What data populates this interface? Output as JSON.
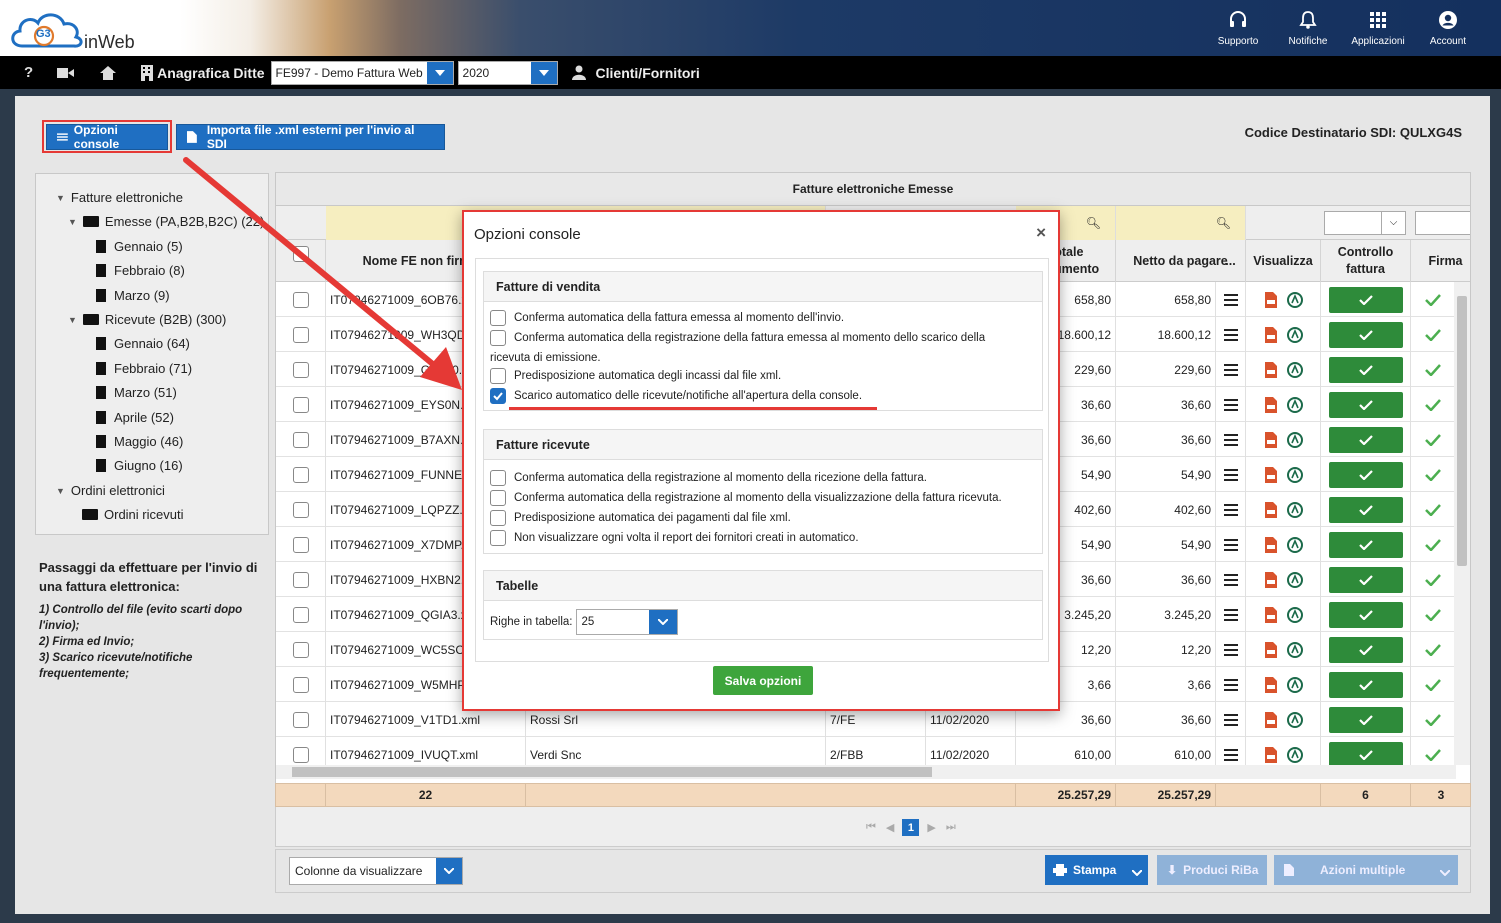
{
  "header": {
    "logo_badge": "G3",
    "app_name": "inWeb",
    "icons": [
      {
        "label": "Supporto",
        "icon": "headset-icon"
      },
      {
        "label": "Notifiche",
        "icon": "bell-icon"
      },
      {
        "label": "Applicazioni",
        "icon": "grid-icon"
      },
      {
        "label": "Account",
        "icon": "user-icon"
      }
    ]
  },
  "navbar": {
    "help": "?",
    "section_label": "Anagrafica Ditte",
    "company_value": "FE997 - Demo Fattura Web",
    "year_value": "2020",
    "clients_label": "Clienti/Fornitori"
  },
  "toolbar": {
    "options_label": "Opzioni console",
    "import_label": "Importa file .xml esterni per l'invio al SDI",
    "sdi_code": "Codice Destinatario SDI: QULXG4S"
  },
  "tree": [
    "Fatture elettroniche",
    "Emesse (PA,B2B,B2C) (22)",
    "Gennaio (5)",
    "Febbraio (8)",
    "Marzo (9)",
    "Ricevute (B2B) (300)",
    "Gennaio (64)",
    "Febbraio (71)",
    "Marzo (51)",
    "Aprile (52)",
    "Maggio (46)",
    "Giugno (16)",
    "Ordini elettronici",
    "Ordini ricevuti"
  ],
  "steps": {
    "title": "Passaggi da effettuare per l'invio di una fattura elettronica:",
    "items": [
      "1) Controllo del file (evito scarti dopo l'invio);",
      "2) Firma ed Invio;",
      "3) Scarico ricevute/notifiche frequentemente;"
    ]
  },
  "grid": {
    "title": "Fatture elettroniche Emesse",
    "headers": {
      "name": "Nome FE non firmata",
      "total": "Totale documento",
      "net": "Netto da pagare",
      "more": "...",
      "view": "Visualizza",
      "control": "Controllo fattura",
      "sign": "Firma"
    },
    "rows": [
      {
        "name": "IT07946271009_6OB76.xml",
        "client": "",
        "num": "",
        "date": "",
        "total": "658,80",
        "net": "658,80"
      },
      {
        "name": "IT07946271009_WH3QD.xml",
        "client": "",
        "num": "",
        "date": "",
        "total": "18.600,12",
        "net": "18.600,12"
      },
      {
        "name": "IT07946271009_GZ2Y0.xml",
        "client": "",
        "num": "",
        "date": "",
        "total": "229,60",
        "net": "229,60"
      },
      {
        "name": "IT07946271009_EYS0N.xml",
        "client": "",
        "num": "",
        "date": "",
        "total": "36,60",
        "net": "36,60"
      },
      {
        "name": "IT07946271009_B7AXN.xml",
        "client": "",
        "num": "",
        "date": "",
        "total": "36,60",
        "net": "36,60"
      },
      {
        "name": "IT07946271009_FUNNE.xml",
        "client": "",
        "num": "",
        "date": "",
        "total": "54,90",
        "net": "54,90"
      },
      {
        "name": "IT07946271009_LQPZZ.xml",
        "client": "",
        "num": "",
        "date": "",
        "total": "402,60",
        "net": "402,60"
      },
      {
        "name": "IT07946271009_X7DMP.xml",
        "client": "",
        "num": "",
        "date": "",
        "total": "54,90",
        "net": "54,90"
      },
      {
        "name": "IT07946271009_HXBN2.xml",
        "client": "",
        "num": "",
        "date": "",
        "total": "36,60",
        "net": "36,60"
      },
      {
        "name": "IT07946271009_QGIA3.xml",
        "client": "",
        "num": "",
        "date": "",
        "total": "3.245,20",
        "net": "3.245,20"
      },
      {
        "name": "IT07946271009_WC5SC.xml",
        "client": "",
        "num": "",
        "date": "",
        "total": "12,20",
        "net": "12,20"
      },
      {
        "name": "IT07946271009_W5MHP.xml",
        "client": "",
        "num": "",
        "date": "",
        "total": "3,66",
        "net": "3,66"
      },
      {
        "name": "IT07946271009_V1TD1.xml",
        "client": "Rossi Srl",
        "num": "7/FE",
        "date": "11/02/2020",
        "total": "36,60",
        "net": "36,60"
      },
      {
        "name": "IT07946271009_IVUQT.xml",
        "client": "Verdi Snc",
        "num": "2/FBB",
        "date": "11/02/2020",
        "total": "610,00",
        "net": "610,00"
      }
    ],
    "totals": {
      "count": "22",
      "total": "25.257,29",
      "net": "25.257,29",
      "control": "6",
      "sign": "3"
    },
    "page": "1"
  },
  "bottom": {
    "columns_label": "Colonne da visualizzare",
    "print_label": "Stampa",
    "riba_label": "Produci RiBa",
    "multi_label": "Azioni multiple"
  },
  "modal": {
    "title": "Opzioni console",
    "close": "×",
    "sales_title": "Fatture di vendita",
    "sales_options": [
      {
        "text": "Conferma automatica della fattura emessa al momento dell'invio.",
        "checked": false
      },
      {
        "text": "Conferma automatica della registrazione della fattura emessa al momento dello scarico della",
        "text2": "ricevuta di emissione.",
        "checked": false
      },
      {
        "text": "Predisposizione automatica degli incassi dal file xml.",
        "checked": false
      },
      {
        "text": "Scarico automatico delle ricevute/notifiche all'apertura della console.",
        "checked": true
      }
    ],
    "received_title": "Fatture ricevute",
    "received_options": [
      {
        "text": "Conferma automatica della registrazione al momento della ricezione della fattura.",
        "checked": false
      },
      {
        "text": "Conferma automatica della registrazione al momento della visualizzazione della fattura ricevuta.",
        "checked": false
      },
      {
        "text": "Predisposizione automatica dei pagamenti dal file xml.",
        "checked": false
      },
      {
        "text": "Non visualizzare ogni volta il report dei fornitori creati in automatico.",
        "checked": false
      }
    ],
    "tables_title": "Tabelle",
    "rows_label": "Righe in tabella:",
    "rows_value": "25",
    "save_label": "Salva opzioni"
  },
  "colors": {
    "accent": "#1f6fc2",
    "success": "#2e8b3a",
    "highlight": "#e53935"
  }
}
